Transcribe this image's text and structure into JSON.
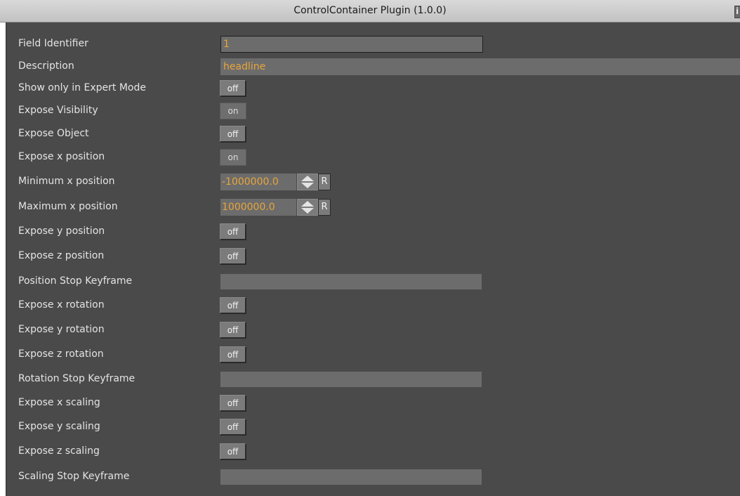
{
  "window": {
    "title": "ControlContainer Plugin (1.0.0)",
    "info_glyph": "i"
  },
  "fields": {
    "field_identifier": {
      "label": "Field Identifier",
      "value": "1"
    },
    "description": {
      "label": "Description",
      "value": "headline"
    },
    "show_expert": {
      "label": "Show only in Expert Mode",
      "state": "off"
    },
    "expose_visibility": {
      "label": "Expose Visibility",
      "state": "on"
    },
    "expose_object": {
      "label": "Expose Object",
      "state": "off"
    },
    "expose_x_position": {
      "label": "Expose x position",
      "state": "on"
    },
    "min_x_position": {
      "label": "Minimum x position",
      "value": "-1000000.0",
      "reset": "R"
    },
    "max_x_position": {
      "label": "Maximum x position",
      "value": "1000000.0",
      "reset": "R"
    },
    "expose_y_position": {
      "label": "Expose y position",
      "state": "off"
    },
    "expose_z_position": {
      "label": "Expose z position",
      "state": "off"
    },
    "position_stop_keyframe": {
      "label": "Position Stop Keyframe",
      "value": ""
    },
    "expose_x_rotation": {
      "label": "Expose x rotation",
      "state": "off"
    },
    "expose_y_rotation": {
      "label": "Expose y rotation",
      "state": "off"
    },
    "expose_z_rotation": {
      "label": "Expose z rotation",
      "state": "off"
    },
    "rotation_stop_keyframe": {
      "label": "Rotation Stop Keyframe",
      "value": ""
    },
    "expose_x_scaling": {
      "label": "Expose x scaling",
      "state": "off"
    },
    "expose_y_scaling": {
      "label": "Expose y scaling",
      "state": "off"
    },
    "expose_z_scaling": {
      "label": "Expose z scaling",
      "state": "off"
    },
    "scaling_stop_keyframe": {
      "label": "Scaling Stop Keyframe",
      "value": ""
    }
  },
  "colors": {
    "panel_bg": "#4a4a4a",
    "value_text": "#e9a53a",
    "label_text": "#e4e4e4"
  },
  "icons": {
    "spinner": "up-down-arrows-icon",
    "info": "info-icon"
  }
}
